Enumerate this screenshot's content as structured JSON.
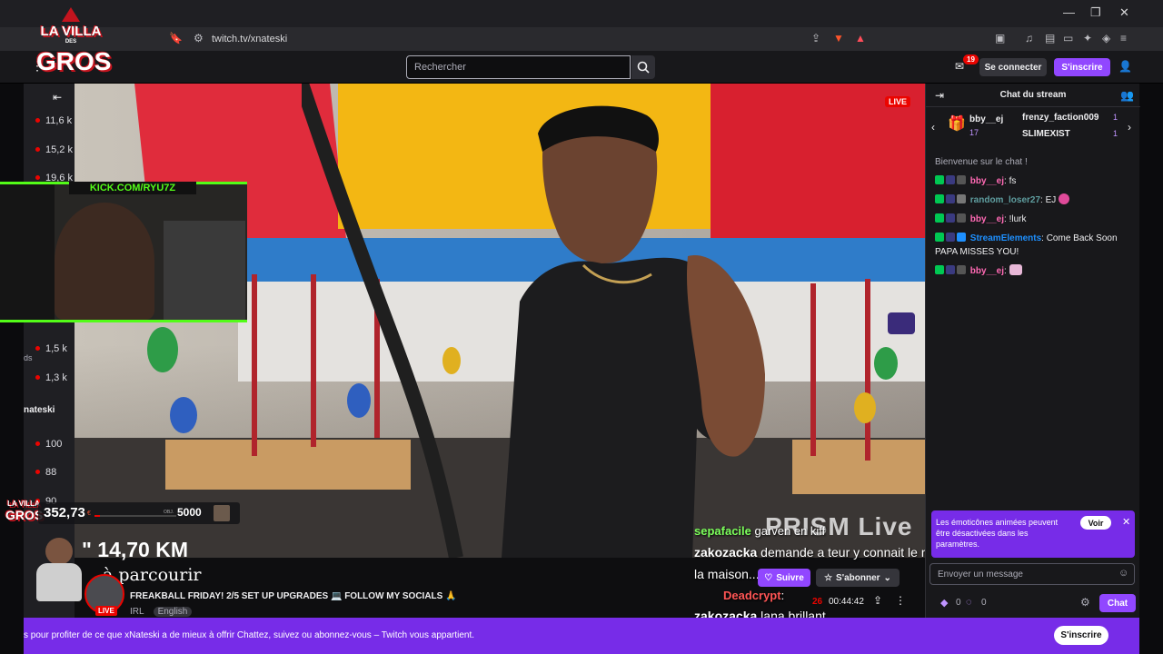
{
  "browser": {
    "url": "twitch.tv/xnateski",
    "window_controls": {
      "minimize": "—",
      "maximize": "❐",
      "close": "✕"
    }
  },
  "logo": {
    "line1": "LA VILLA",
    "line2": "GROS",
    "line_small": "DES"
  },
  "topnav": {
    "search_placeholder": "Rechercher",
    "notif_count": "19",
    "login_label": "Se connecter",
    "signup_label": "S'inscrire"
  },
  "sidebar": {
    "items": [
      "11,6 k",
      "15,2 k",
      "19,6 k",
      "1,5 k",
      "1,3 k",
      "100",
      "88",
      "90"
    ],
    "channel_partial": "nateski",
    "partial_text": "ds"
  },
  "video": {
    "live_label": "LIVE",
    "kick_label": "KICK.COM/RYU7Z",
    "watermark": "PRISM Live"
  },
  "overlay": {
    "stats_value": "352,73",
    "stats_unit": "€",
    "stats_goal": "5000",
    "stats_small": "OBJ.",
    "logo_small": "LA VILLA",
    "logo_small2": "GROS",
    "km": "\" 14,70 KM",
    "km_sub": "à parcourir",
    "chat_lines": [
      {
        "user": "sepafacile",
        "text": " garven en kiff"
      },
      {
        "user": "zakozacka",
        "text": " demande a teur y connait le mieux qui a tourner dans"
      },
      {
        "user": "",
        "text": "la maison..."
      },
      {
        "user": "Deadcrypt",
        "text": ": "
      },
      {
        "user": "zakozacka",
        "text": " lana brillant"
      }
    ]
  },
  "stream_info": {
    "live_label": "LIVE",
    "title": "FREAKBALL FRIDAY! 2/5 SET UP UPGRADES 💻 FOLLOW MY SOCIALS 🙏",
    "category": "IRL",
    "language": "English",
    "follow_label": "Suivre",
    "subscribe_label": "S'abonner",
    "viewers": "26",
    "uptime": "00:44:42"
  },
  "chat": {
    "title": "Chat du stream",
    "gift_left_user": "bby__ej",
    "gift_left_count": "17",
    "gift_users": [
      {
        "name": "frenzy_faction009",
        "count": "1"
      },
      {
        "name": "SLIMEXIST",
        "count": "1"
      }
    ],
    "welcome": "Bienvenue sur le chat !",
    "messages": [
      {
        "user": "bby__ej",
        "color": "#ff69b4",
        "text": ": fs"
      },
      {
        "user": "random_loser27",
        "color": "#5f9ea0",
        "text": ": EJ"
      },
      {
        "user": "bby__ej",
        "color": "#ff69b4",
        "text": ": !lurk"
      },
      {
        "user": "StreamElements",
        "color": "#1e90ff",
        "text": ": Come Back Soon PAPA MISSES YOU!"
      },
      {
        "user": "bby__ej",
        "color": "#ff69b4",
        "text": ":"
      }
    ],
    "emote_note": "Les émoticônes animées peuvent être désactivées dans les paramètres.",
    "voir_label": "Voir",
    "input_placeholder": "Envoyer un message",
    "points": "0",
    "points2": "0",
    "send_label": "Chat"
  },
  "banner": {
    "text": "s pour profiter de ce que xNateski a de mieux à offrir  Chattez, suivez ou abonnez-vous – Twitch vous appartient.",
    "button": "S'inscrire"
  },
  "colors": {
    "twitch_purple": "#9147ff",
    "banner_purple": "#772ce8",
    "live_red": "#eb0400",
    "kick_green": "#53fc18"
  }
}
